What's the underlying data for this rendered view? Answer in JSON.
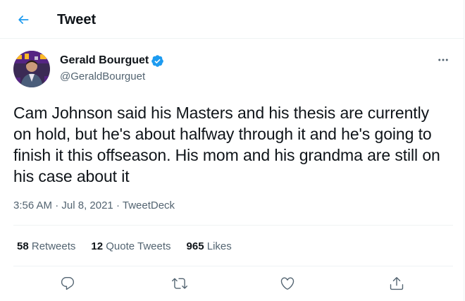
{
  "header": {
    "back_icon": "arrow-left-icon",
    "title": "Tweet"
  },
  "author": {
    "name": "Gerald Bourguet",
    "handle": "@GeraldBourguet",
    "verified_icon": "verified-badge-icon"
  },
  "tweet": {
    "text": "Cam Johnson said his Masters and his thesis are currently on hold, but he's about halfway through it and he's going to finish it this offseason. His mom and his grandma are still on his case about it",
    "time": "3:56 AM",
    "separator": "·",
    "date": "Jul 8, 2021",
    "source": "TweetDeck"
  },
  "stats": {
    "retweets_count": "58",
    "retweets_label": "Retweets",
    "quotes_count": "12",
    "quotes_label": "Quote Tweets",
    "likes_count": "965",
    "likes_label": "Likes"
  },
  "actions": [
    "reply-icon",
    "retweet-icon",
    "like-icon",
    "share-icon"
  ],
  "colors": {
    "accent": "#1d9bf0",
    "text_primary": "#0f1419",
    "text_secondary": "#536471",
    "border": "#eff3f4",
    "avatar_purple": "#552583",
    "avatar_gold": "#fdb927"
  }
}
